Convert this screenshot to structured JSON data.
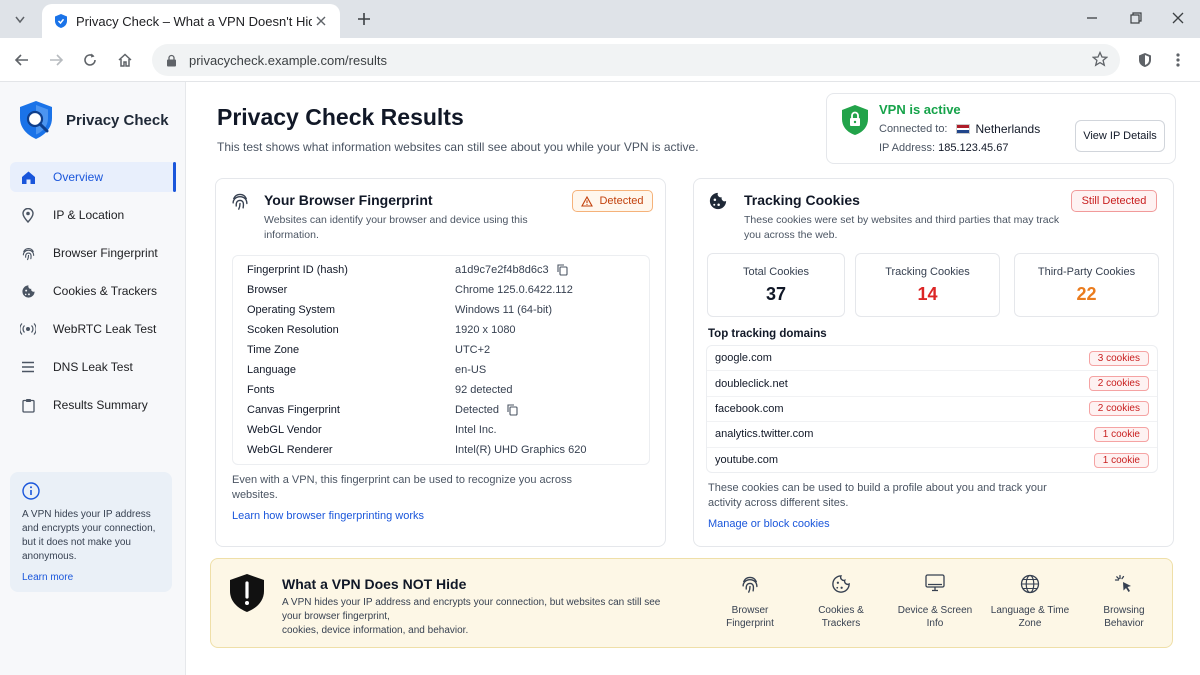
{
  "browser": {
    "tab_title": "Privacy Check – What a VPN Doesn't Hide",
    "url": "privacycheck.example.com/results"
  },
  "sidebar": {
    "brand": "Privacy Check",
    "items": [
      {
        "label": "Overview",
        "icon": "home-icon",
        "active": true
      },
      {
        "label": "IP & Location",
        "icon": "location-pin-icon"
      },
      {
        "label": "Browser Fingerprint",
        "icon": "fingerprint-icon"
      },
      {
        "label": "Cookies & Trackers",
        "icon": "cookie-icon"
      },
      {
        "label": "WebRTC Leak Test",
        "icon": "webrtc-icon"
      },
      {
        "label": "DNS Leak Test",
        "icon": "list-icon"
      },
      {
        "label": "Results Summary",
        "icon": "clipboard-icon"
      }
    ],
    "info": {
      "text": "A VPN hides your IP address and encrypts your connection, but it does not make you anonymous.",
      "link": "Learn more"
    }
  },
  "header": {
    "title": "Privacy Check Results",
    "subtitle": "This test shows what information websites can still see about you while your VPN is active."
  },
  "vpn": {
    "status": "VPN is active",
    "connected_label": "Connected to:",
    "country": "Netherlands",
    "ip_label": "IP Address:",
    "ip": "185.123.45.67",
    "button": "View IP Details",
    "status_color": "#16a34a"
  },
  "fingerprint": {
    "title": "Your Browser Fingerprint",
    "badge": "Detected",
    "description": "Websites can identify your browser and device using this information.",
    "rows": [
      {
        "label": "Fingerprint ID (hash)",
        "value": "a1d9c7e2f4b8d6c3",
        "copy": true
      },
      {
        "label": "Browser",
        "value": "Chrome 125.0.6422.112"
      },
      {
        "label": "Operating System",
        "value": "Windows 11 (64-bit)"
      },
      {
        "label": "Scoken Resolution",
        "value": "1920 x 1080"
      },
      {
        "label": "Time Zone",
        "value": "UTC+2"
      },
      {
        "label": "Language",
        "value": "en-US"
      },
      {
        "label": "Fonts",
        "value": "92 detected"
      },
      {
        "label": "Canvas Fingerprint",
        "value": "Detected",
        "copy": true
      },
      {
        "label": "WebGL Vendor",
        "value": "Intel Inc."
      },
      {
        "label": "WebGL Renderer",
        "value": "Intel(R) UHD Graphics 620"
      }
    ],
    "note": "Even with a VPN, this fingerprint can be used to recognize you across websites.",
    "link": "Learn how browser fingerprinting works"
  },
  "cookies": {
    "title": "Tracking Cookies",
    "badge": "Still Detected",
    "description": "These cookies were set by websites and third parties that may track you across the web.",
    "stats": [
      {
        "label": "Total Cookies",
        "value": "37",
        "color": "#111827"
      },
      {
        "label": "Tracking Cookies",
        "value": "14",
        "color": "#dc2626"
      },
      {
        "label": "Third-Party Cookies",
        "value": "22",
        "color": "#ea7c1e"
      }
    ],
    "domains_title": "Top tracking domains",
    "domains": [
      {
        "domain": "google.com",
        "count": "3 cookies"
      },
      {
        "domain": "doubleclick.net",
        "count": "2 cookies"
      },
      {
        "domain": "facebook.com",
        "count": "2 cookies"
      },
      {
        "domain": "analytics.twitter.com",
        "count": "1 cookie"
      },
      {
        "domain": "youtube.com",
        "count": "1 cookie"
      }
    ],
    "note": "These cookies can be used to build a profile about you and track your activity across different sites.",
    "link": "Manage or block cookies"
  },
  "banner": {
    "title": "What a VPN Does NOT Hide",
    "desc_1": "A VPN hides your IP address and encrypts your connection, but websites can still see your browser fingerprint,",
    "desc_2": "cookies, device information, and behavior.",
    "items": [
      {
        "label": "Browser Fingerprint",
        "icon": "fingerprint-icon"
      },
      {
        "label": "Cookies & Trackers",
        "icon": "cookie-icon"
      },
      {
        "label": "Device & Screen Info",
        "icon": "monitor-icon"
      },
      {
        "label": "Language & Time Zone",
        "icon": "globe-icon"
      },
      {
        "label": "Browsing Behavior",
        "icon": "cursor-click-icon"
      }
    ]
  }
}
